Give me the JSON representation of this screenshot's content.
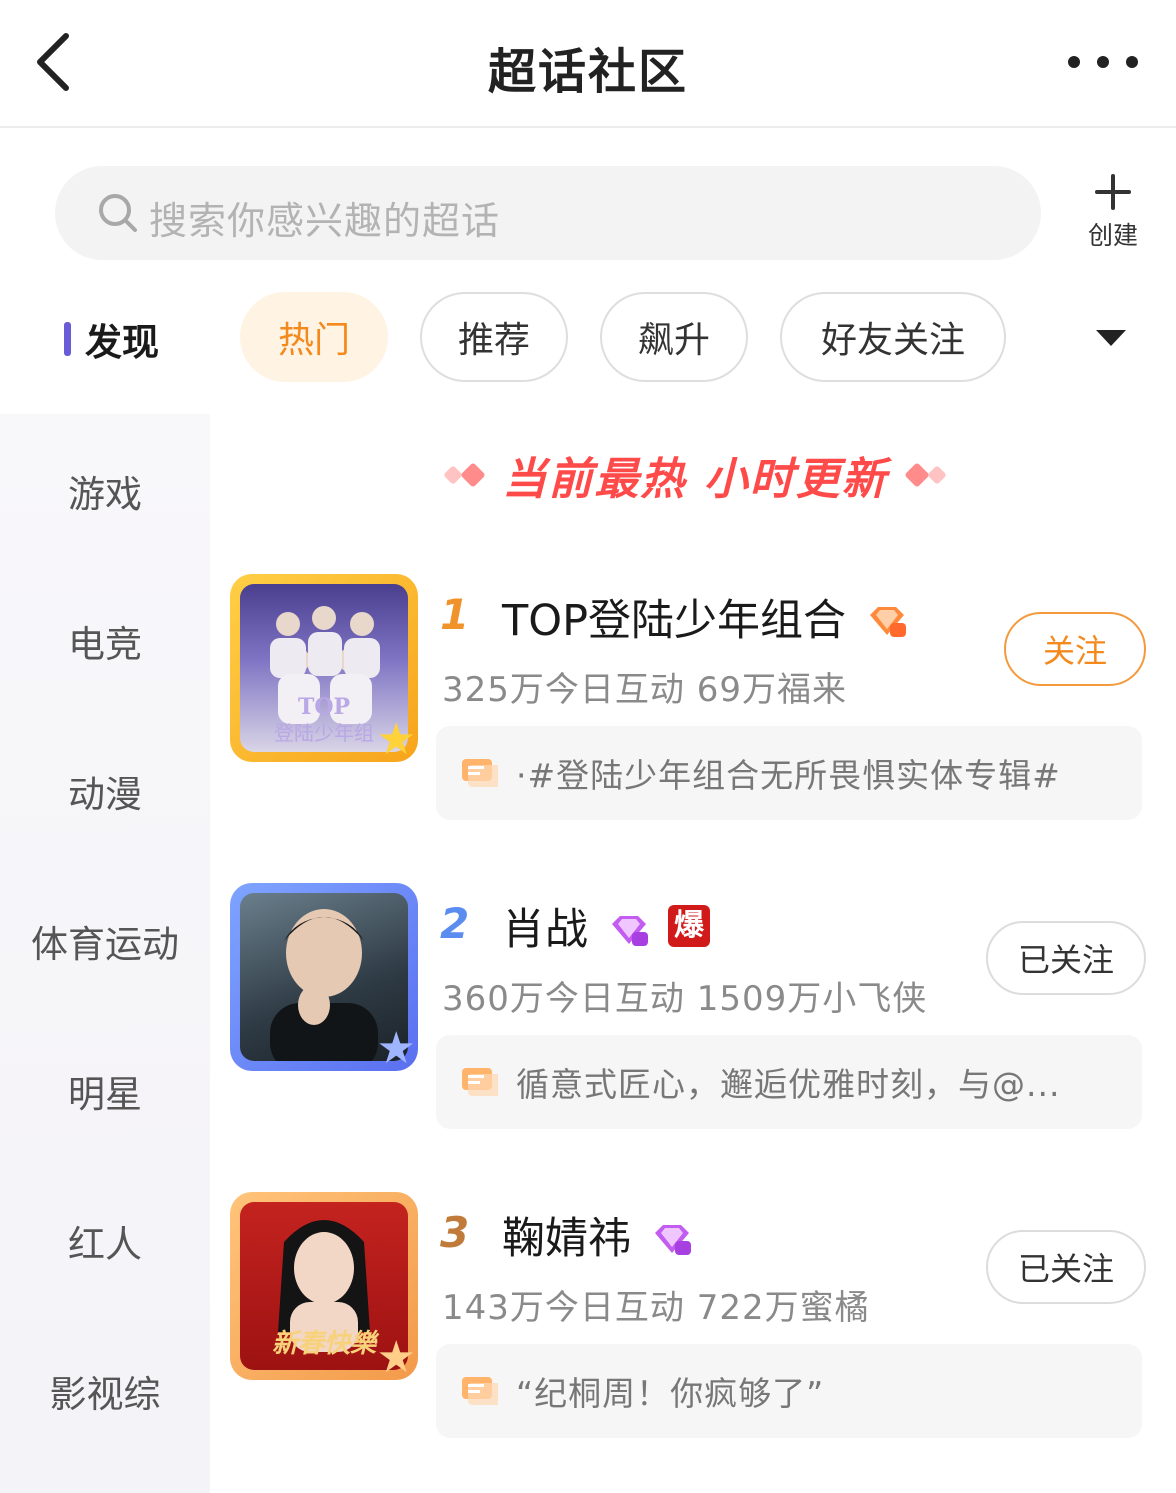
{
  "header": {
    "title": "超话社区"
  },
  "search": {
    "placeholder": "搜索你感兴趣的超话"
  },
  "create": {
    "label": "创建"
  },
  "sidebar": {
    "active": "发现",
    "items": [
      "游戏",
      "电竞",
      "动漫",
      "体育运动",
      "明星",
      "红人",
      "影视综"
    ]
  },
  "tabs": [
    "热门",
    "推荐",
    "飙升",
    "好友关注"
  ],
  "banner": {
    "text": "当前最热 小时更新"
  },
  "colors": {
    "accent": "#f48a1e",
    "banner": "#ff4a4a",
    "nav_indicator": "#6a5cd6"
  },
  "topics": [
    {
      "rank": "1",
      "name": "TOP登陆少年组合",
      "badges": [
        "diamond-badge-orange"
      ],
      "stats": "325万今日互动 69万福来",
      "follow": "关注",
      "followed": false,
      "quote": "·#登陆少年组合无所畏惧实体专辑#",
      "thumb_text": "TOP\n登陆少年组"
    },
    {
      "rank": "2",
      "name": "肖战",
      "badges": [
        "diamond-badge-purple",
        "爆"
      ],
      "stats": "360万今日互动 1509万小飞侠",
      "follow": "已关注",
      "followed": true,
      "quote": "循意式匠心，邂逅优雅时刻，与@..."
    },
    {
      "rank": "3",
      "name": "鞠婧祎",
      "badges": [
        "diamond-badge-purple"
      ],
      "stats": "143万今日互动 722万蜜橘",
      "follow": "已关注",
      "followed": true,
      "quote": "“纪桐周！你疯够了”",
      "thumb_text": "新春快乐"
    }
  ]
}
